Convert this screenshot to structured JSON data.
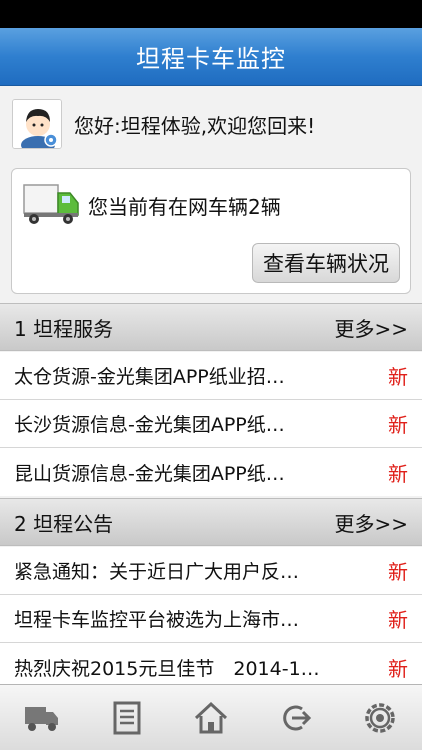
{
  "app": {
    "title": "坦程卡车监控"
  },
  "greeting": {
    "text": "您好:坦程体验,欢迎您回来!"
  },
  "vehicle": {
    "text": "您当前有在网车辆2辆",
    "button_label": "查看车辆状况"
  },
  "sections": [
    {
      "title": "1 坦程服务",
      "more_label": "更多>>",
      "items": [
        {
          "title": "太仓货源-金光集团APP纸业招…",
          "badge": "新"
        },
        {
          "title": "长沙货源信息-金光集团APP纸…",
          "badge": "新"
        },
        {
          "title": "昆山货源信息-金光集团APP纸…",
          "badge": "新"
        }
      ]
    },
    {
      "title": "2 坦程公告",
      "more_label": "更多>>",
      "items": [
        {
          "title": "紧急通知：关于近日广大用户反…",
          "badge": "新"
        },
        {
          "title": "坦程卡车监控平台被选为上海市…",
          "badge": "新"
        },
        {
          "title": "热烈庆祝2015元旦佳节　2014-1…",
          "badge": "新"
        }
      ]
    }
  ],
  "tabs": [
    {
      "icon": "truck-icon"
    },
    {
      "icon": "document-icon"
    },
    {
      "icon": "home-icon"
    },
    {
      "icon": "logout-icon"
    },
    {
      "icon": "settings-icon"
    }
  ],
  "colors": {
    "nav_blue": "#2f7fcf",
    "badge_red": "#e0201a"
  }
}
